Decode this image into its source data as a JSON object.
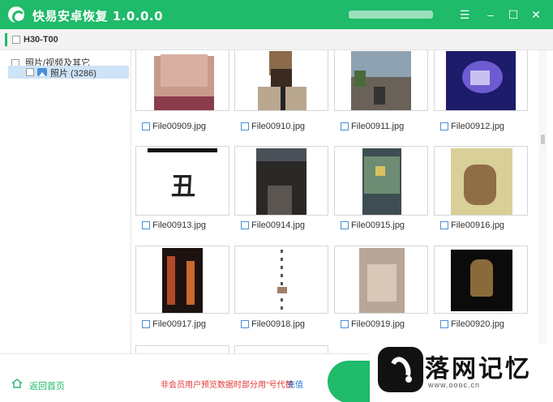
{
  "app": {
    "title": "快易安卓恢复 1.0.0.0"
  },
  "window_controls": {
    "menu": "☰",
    "minimize": "–",
    "maximize": "☐",
    "close": "✕"
  },
  "device": {
    "name": "H30-T00"
  },
  "sidebar": {
    "root_label": "照片/视频及其它",
    "child_label": "照片 (3286)"
  },
  "files": [
    {
      "name": "File00909.jpg"
    },
    {
      "name": "File00910.jpg"
    },
    {
      "name": "File00911.jpg"
    },
    {
      "name": "File00912.jpg"
    },
    {
      "name": "File00913.jpg"
    },
    {
      "name": "File00914.jpg"
    },
    {
      "name": "File00915.jpg"
    },
    {
      "name": "File00916.jpg"
    },
    {
      "name": "File00917.jpg"
    },
    {
      "name": "File00918.jpg"
    },
    {
      "name": "File00919.jpg"
    },
    {
      "name": "File00920.jpg"
    }
  ],
  "thumb_glyph_913": "丑",
  "footer": {
    "home_label": "返回首页",
    "notice": "非会员用户预览数据时部分用\"号代替",
    "recharge": "充值"
  },
  "watermark": {
    "text": "落网记忆",
    "url": "www.oooc.cn"
  },
  "colors": {
    "brand": "#1fba6a",
    "selection": "#cde3f7",
    "notice": "#e53935",
    "link": "#1a73d9"
  }
}
